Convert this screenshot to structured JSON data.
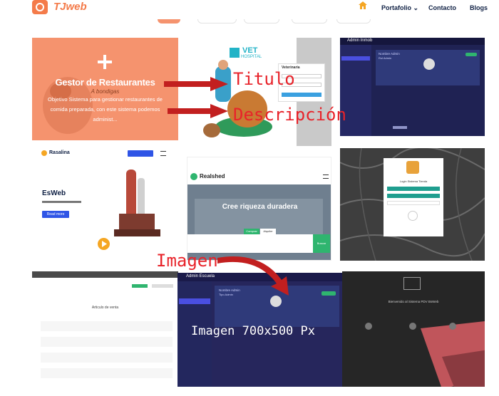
{
  "header": {
    "brand": "TJweb",
    "nav": [
      "Portafolio",
      "Contacto",
      "Blogs"
    ],
    "portfolio_caret": "⌄",
    "colors": {
      "brand": "#f47b4a",
      "nav": "#0f2044"
    }
  },
  "cards": {
    "restaurant": {
      "title": "Gestor de Restaurantes",
      "subtitle": "A bondigas",
      "description": "Objetivo Sistema para gestionar restaurantes de comida preparada, con este sistema podemos administ..."
    },
    "vet": {
      "logo_line1": "VET",
      "logo_line2": "HOSPITAL",
      "login_title": "Veterinaria"
    },
    "admin_dark": {
      "app": "Admin Inmob",
      "name": "Nombre Admin",
      "role": "Rol Admin"
    },
    "esweb": {
      "brand": "Rasalina",
      "title": "EsWeb",
      "cta": "Read more"
    },
    "realshed": {
      "brand": "Realshed",
      "hero": "Cree riqueza duradera",
      "tab1": "Comprar",
      "tab2": "Alquiler",
      "search": "Buscar"
    },
    "login_teal": {
      "title": "Login Sistema Tienda"
    },
    "table_app": {
      "heading": "Articulo de venta"
    },
    "admin_big": {
      "app": "Admin Escuela",
      "name": "Nombre Admin",
      "role": "Tipo Admin"
    },
    "pdv": {
      "title": "Bienvenido al Sistema PDV BsWeb"
    }
  },
  "annotations": {
    "titulo": "Titulo",
    "descripcion": "Descripción",
    "imagen": "Imagen",
    "imagen_size": "Imagen 700x500 Px",
    "color": "#e8232a"
  }
}
